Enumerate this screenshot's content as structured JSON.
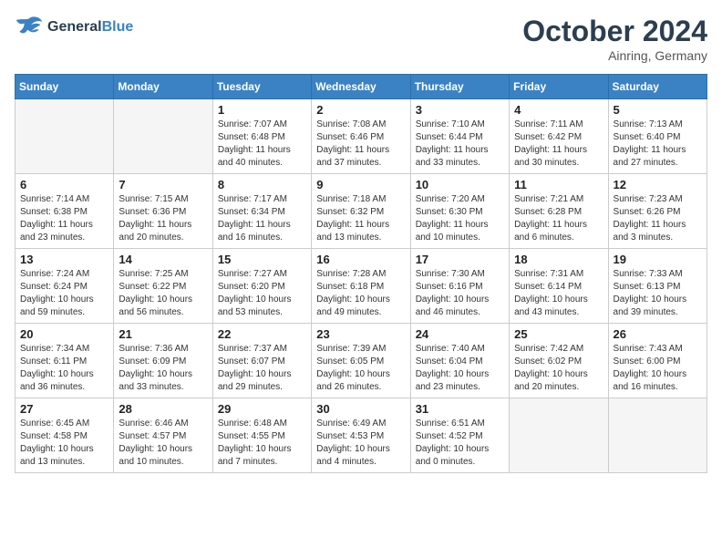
{
  "header": {
    "logo_line1": "General",
    "logo_line2": "Blue",
    "month_title": "October 2024",
    "location": "Ainring, Germany"
  },
  "weekdays": [
    "Sunday",
    "Monday",
    "Tuesday",
    "Wednesday",
    "Thursday",
    "Friday",
    "Saturday"
  ],
  "weeks": [
    [
      {
        "day": "",
        "empty": true
      },
      {
        "day": "",
        "empty": true
      },
      {
        "day": "1",
        "sunrise": "Sunrise: 7:07 AM",
        "sunset": "Sunset: 6:48 PM",
        "daylight": "Daylight: 11 hours and 40 minutes."
      },
      {
        "day": "2",
        "sunrise": "Sunrise: 7:08 AM",
        "sunset": "Sunset: 6:46 PM",
        "daylight": "Daylight: 11 hours and 37 minutes."
      },
      {
        "day": "3",
        "sunrise": "Sunrise: 7:10 AM",
        "sunset": "Sunset: 6:44 PM",
        "daylight": "Daylight: 11 hours and 33 minutes."
      },
      {
        "day": "4",
        "sunrise": "Sunrise: 7:11 AM",
        "sunset": "Sunset: 6:42 PM",
        "daylight": "Daylight: 11 hours and 30 minutes."
      },
      {
        "day": "5",
        "sunrise": "Sunrise: 7:13 AM",
        "sunset": "Sunset: 6:40 PM",
        "daylight": "Daylight: 11 hours and 27 minutes."
      }
    ],
    [
      {
        "day": "6",
        "sunrise": "Sunrise: 7:14 AM",
        "sunset": "Sunset: 6:38 PM",
        "daylight": "Daylight: 11 hours and 23 minutes."
      },
      {
        "day": "7",
        "sunrise": "Sunrise: 7:15 AM",
        "sunset": "Sunset: 6:36 PM",
        "daylight": "Daylight: 11 hours and 20 minutes."
      },
      {
        "day": "8",
        "sunrise": "Sunrise: 7:17 AM",
        "sunset": "Sunset: 6:34 PM",
        "daylight": "Daylight: 11 hours and 16 minutes."
      },
      {
        "day": "9",
        "sunrise": "Sunrise: 7:18 AM",
        "sunset": "Sunset: 6:32 PM",
        "daylight": "Daylight: 11 hours and 13 minutes."
      },
      {
        "day": "10",
        "sunrise": "Sunrise: 7:20 AM",
        "sunset": "Sunset: 6:30 PM",
        "daylight": "Daylight: 11 hours and 10 minutes."
      },
      {
        "day": "11",
        "sunrise": "Sunrise: 7:21 AM",
        "sunset": "Sunset: 6:28 PM",
        "daylight": "Daylight: 11 hours and 6 minutes."
      },
      {
        "day": "12",
        "sunrise": "Sunrise: 7:23 AM",
        "sunset": "Sunset: 6:26 PM",
        "daylight": "Daylight: 11 hours and 3 minutes."
      }
    ],
    [
      {
        "day": "13",
        "sunrise": "Sunrise: 7:24 AM",
        "sunset": "Sunset: 6:24 PM",
        "daylight": "Daylight: 10 hours and 59 minutes."
      },
      {
        "day": "14",
        "sunrise": "Sunrise: 7:25 AM",
        "sunset": "Sunset: 6:22 PM",
        "daylight": "Daylight: 10 hours and 56 minutes."
      },
      {
        "day": "15",
        "sunrise": "Sunrise: 7:27 AM",
        "sunset": "Sunset: 6:20 PM",
        "daylight": "Daylight: 10 hours and 53 minutes."
      },
      {
        "day": "16",
        "sunrise": "Sunrise: 7:28 AM",
        "sunset": "Sunset: 6:18 PM",
        "daylight": "Daylight: 10 hours and 49 minutes."
      },
      {
        "day": "17",
        "sunrise": "Sunrise: 7:30 AM",
        "sunset": "Sunset: 6:16 PM",
        "daylight": "Daylight: 10 hours and 46 minutes."
      },
      {
        "day": "18",
        "sunrise": "Sunrise: 7:31 AM",
        "sunset": "Sunset: 6:14 PM",
        "daylight": "Daylight: 10 hours and 43 minutes."
      },
      {
        "day": "19",
        "sunrise": "Sunrise: 7:33 AM",
        "sunset": "Sunset: 6:13 PM",
        "daylight": "Daylight: 10 hours and 39 minutes."
      }
    ],
    [
      {
        "day": "20",
        "sunrise": "Sunrise: 7:34 AM",
        "sunset": "Sunset: 6:11 PM",
        "daylight": "Daylight: 10 hours and 36 minutes."
      },
      {
        "day": "21",
        "sunrise": "Sunrise: 7:36 AM",
        "sunset": "Sunset: 6:09 PM",
        "daylight": "Daylight: 10 hours and 33 minutes."
      },
      {
        "day": "22",
        "sunrise": "Sunrise: 7:37 AM",
        "sunset": "Sunset: 6:07 PM",
        "daylight": "Daylight: 10 hours and 29 minutes."
      },
      {
        "day": "23",
        "sunrise": "Sunrise: 7:39 AM",
        "sunset": "Sunset: 6:05 PM",
        "daylight": "Daylight: 10 hours and 26 minutes."
      },
      {
        "day": "24",
        "sunrise": "Sunrise: 7:40 AM",
        "sunset": "Sunset: 6:04 PM",
        "daylight": "Daylight: 10 hours and 23 minutes."
      },
      {
        "day": "25",
        "sunrise": "Sunrise: 7:42 AM",
        "sunset": "Sunset: 6:02 PM",
        "daylight": "Daylight: 10 hours and 20 minutes."
      },
      {
        "day": "26",
        "sunrise": "Sunrise: 7:43 AM",
        "sunset": "Sunset: 6:00 PM",
        "daylight": "Daylight: 10 hours and 16 minutes."
      }
    ],
    [
      {
        "day": "27",
        "sunrise": "Sunrise: 6:45 AM",
        "sunset": "Sunset: 4:58 PM",
        "daylight": "Daylight: 10 hours and 13 minutes."
      },
      {
        "day": "28",
        "sunrise": "Sunrise: 6:46 AM",
        "sunset": "Sunset: 4:57 PM",
        "daylight": "Daylight: 10 hours and 10 minutes."
      },
      {
        "day": "29",
        "sunrise": "Sunrise: 6:48 AM",
        "sunset": "Sunset: 4:55 PM",
        "daylight": "Daylight: 10 hours and 7 minutes."
      },
      {
        "day": "30",
        "sunrise": "Sunrise: 6:49 AM",
        "sunset": "Sunset: 4:53 PM",
        "daylight": "Daylight: 10 hours and 4 minutes."
      },
      {
        "day": "31",
        "sunrise": "Sunrise: 6:51 AM",
        "sunset": "Sunset: 4:52 PM",
        "daylight": "Daylight: 10 hours and 0 minutes."
      },
      {
        "day": "",
        "empty": true
      },
      {
        "day": "",
        "empty": true
      }
    ]
  ]
}
